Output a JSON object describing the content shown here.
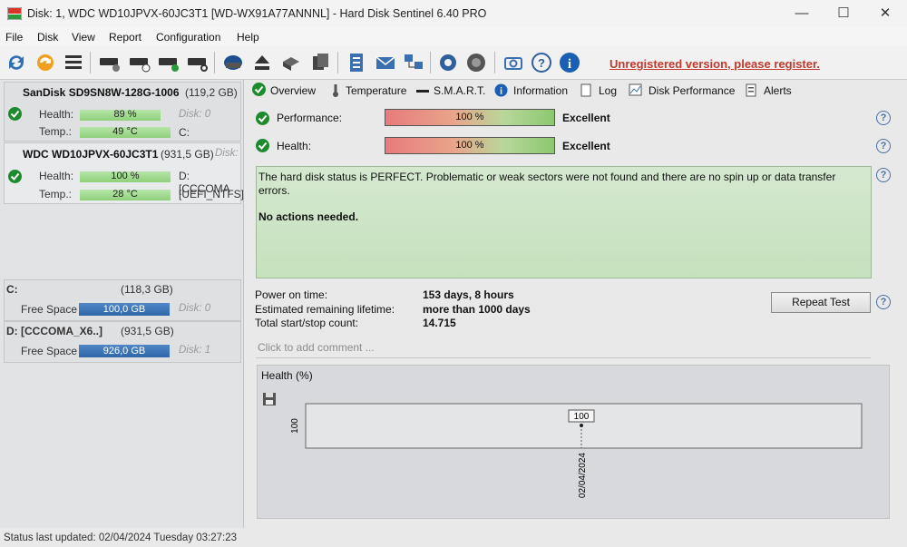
{
  "window": {
    "title": "Disk: 1, WDC WD10JPVX-60JC3T1 [WD-WX91A77ANNNL]  -  Hard Disk Sentinel 6.40 PRO",
    "minimize": "—",
    "maximize": "☐",
    "close": "✕"
  },
  "menu": [
    "File",
    "Disk",
    "View",
    "Report",
    "Configuration",
    "Help"
  ],
  "unregistered_link": "Unregistered version, please register.",
  "disks": [
    {
      "name": "SanDisk SD9SN8W-128G-1006",
      "size": "(119,2 GB)",
      "health_label": "Health:",
      "health_value": "89 %",
      "health_level": 0.89,
      "disk_ref": "Disk: 0",
      "temp_label": "Temp.:",
      "temp_value": "49 °C",
      "volume": "C:"
    },
    {
      "name": "WDC WD10JPVX-60JC3T1",
      "size": "(931,5 GB)",
      "disk_ref": "Disk:",
      "health_label": "Health:",
      "health_value": "100 %",
      "health_level": 1.0,
      "volume": "D: [CCCOMA",
      "temp_label": "Temp.:",
      "temp_value": "28 °C",
      "fs": "[UEFI_NTFS]"
    }
  ],
  "volumes": [
    {
      "name": "C:",
      "size": "(118,3 GB)",
      "free_label": "Free Space",
      "free_value": "100,0 GB",
      "disk_ref": "Disk: 0"
    },
    {
      "name": "D: [CCCOMA_X6..]",
      "size": "(931,5 GB)",
      "free_label": "Free Space",
      "free_value": "926,0 GB",
      "disk_ref": "Disk: 1"
    }
  ],
  "tabs": [
    "Overview",
    "Temperature",
    "S.M.A.R.T.",
    "Information",
    "Log",
    "Disk Performance",
    "Alerts"
  ],
  "overview": {
    "performance_label": "Performance:",
    "performance_value": "100 %",
    "performance_text": "Excellent",
    "health_label": "Health:",
    "health_value": "100 %",
    "health_text": "Excellent",
    "status_text": "The hard disk status is PERFECT. Problematic or weak sectors were not found and there are no spin up or data transfer errors.",
    "action_text": "No actions needed.",
    "power_on_label": "Power on time:",
    "power_on_value": "153 days, 8 hours",
    "lifetime_label": "Estimated remaining lifetime:",
    "lifetime_value": "more than 1000 days",
    "startstop_label": "Total start/stop count:",
    "startstop_value": "14.715",
    "repeat_test": "Repeat Test",
    "comment_placeholder": "Click to add comment ..."
  },
  "chart_data": {
    "type": "line",
    "title": "Health (%)",
    "x": [
      "02/04/2024"
    ],
    "series": [
      {
        "values": [
          100
        ]
      }
    ],
    "y_tick": "100",
    "data_label": "100"
  },
  "status_bar": "Status last updated: 02/04/2024 Tuesday 03:27:23"
}
